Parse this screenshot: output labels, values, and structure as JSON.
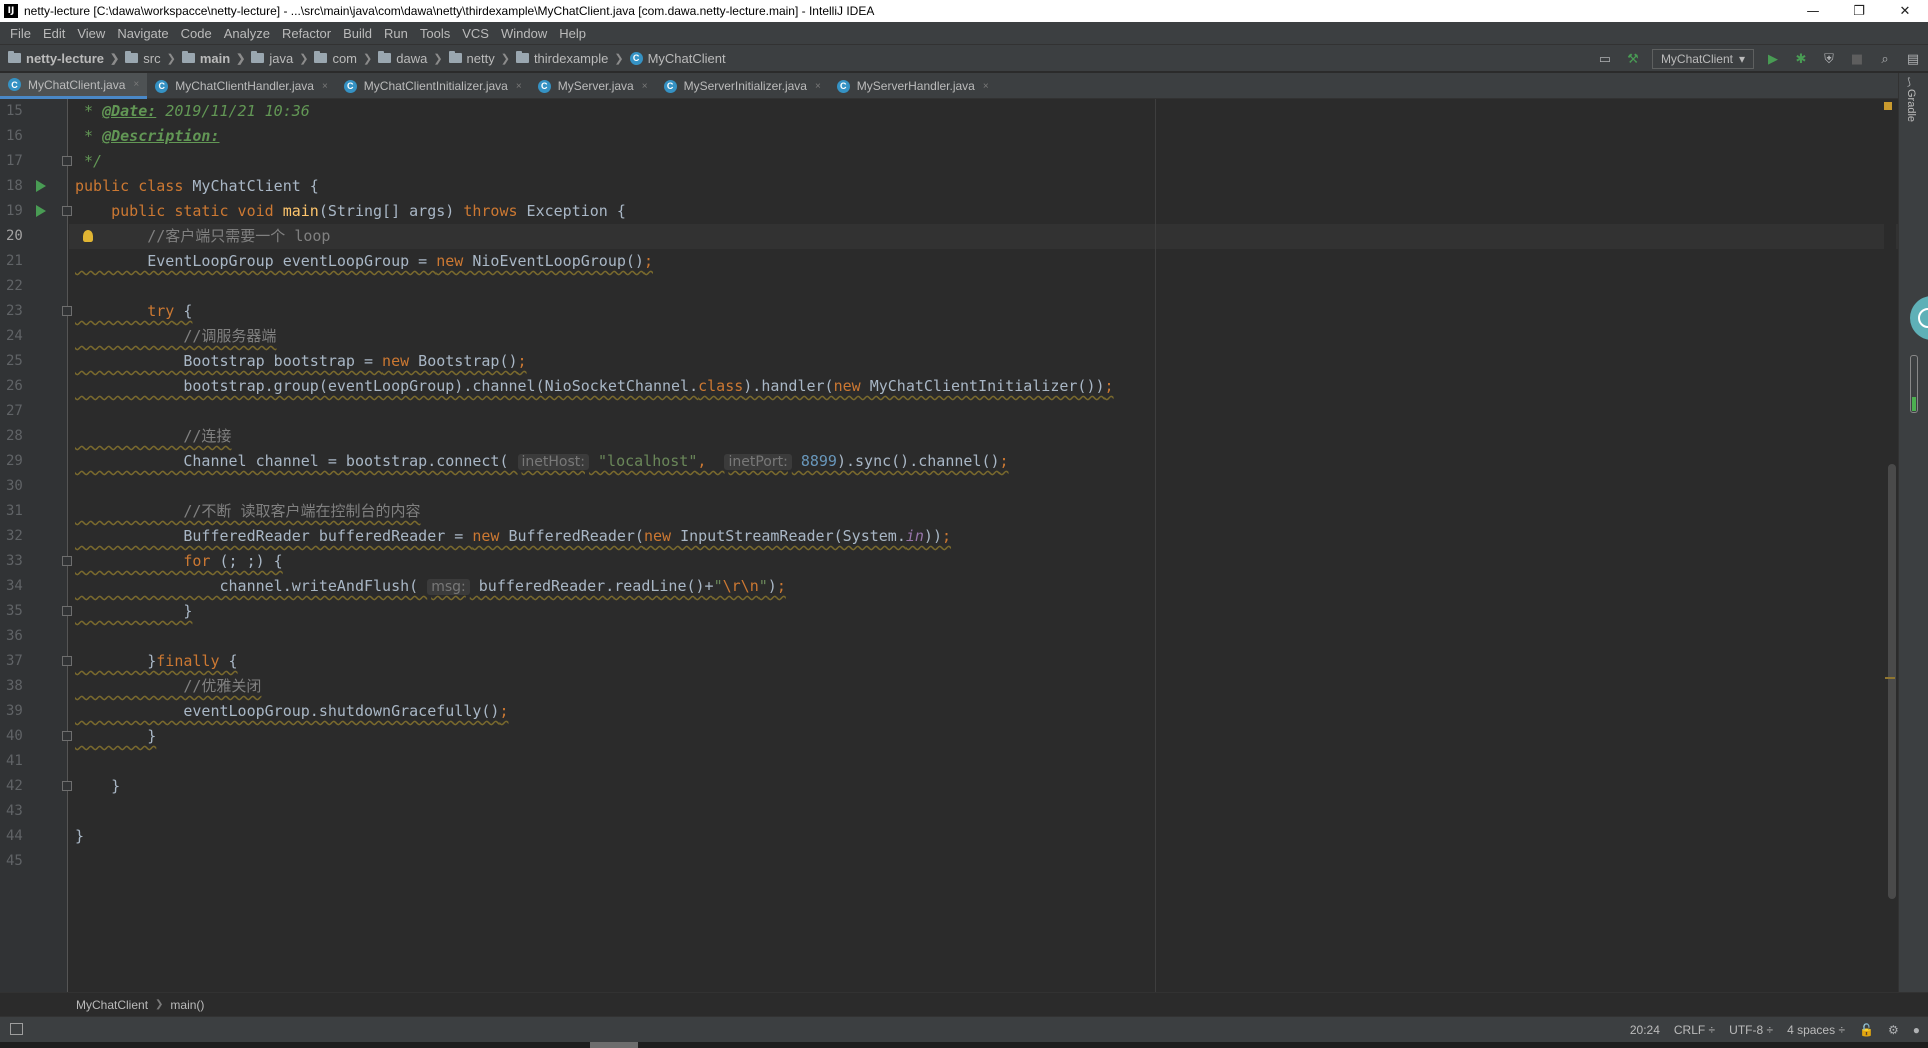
{
  "window": {
    "title": "netty-lecture [C:\\dawa\\workspacce\\netty-lecture] - ...\\src\\main\\java\\com\\dawa\\netty\\thirdexample\\MyChatClient.java [com.dawa.netty-lecture.main] - IntelliJ IDEA",
    "app_icon": "IJ",
    "minimize": "—",
    "restore": "❐",
    "close": "✕"
  },
  "menu": [
    "File",
    "Edit",
    "View",
    "Navigate",
    "Code",
    "Analyze",
    "Refactor",
    "Build",
    "Run",
    "Tools",
    "VCS",
    "Window",
    "Help"
  ],
  "breadcrumbs": [
    "netty-lecture",
    "src",
    "main",
    "java",
    "com",
    "dawa",
    "netty",
    "thirdexample",
    "MyChatClient"
  ],
  "run_config": {
    "label": "MyChatClient",
    "arrow": "▾"
  },
  "toolbar_icons": {
    "layout": "▭",
    "build": "⚒",
    "run": "▶",
    "debug": "✱",
    "coverage": "⛨",
    "stop": "■",
    "search": "⌕",
    "structure": "▤"
  },
  "tabs": [
    {
      "label": "MyChatClient.java",
      "active": true
    },
    {
      "label": "MyChatClientHandler.java",
      "active": false
    },
    {
      "label": "MyChatClientInitializer.java",
      "active": false
    },
    {
      "label": "MyServer.java",
      "active": false
    },
    {
      "label": "MyServerInitializer.java",
      "active": false
    },
    {
      "label": "MyServerHandler.java",
      "active": false
    }
  ],
  "tab_close": "×",
  "class_icon_letter": "C",
  "editor": {
    "line_numbers": [
      "15",
      "16",
      "17",
      "18",
      "19",
      "20",
      "21",
      "22",
      "23",
      "24",
      "25",
      "26",
      "27",
      "28",
      "29",
      "30",
      "31",
      "32",
      "33",
      "34",
      "35",
      "36",
      "37",
      "38",
      "39",
      "40",
      "41",
      "42",
      "43",
      "44",
      "45"
    ],
    "current_line": "20",
    "code": {
      "l15_prefix": " * ",
      "l15_tag": "@Date:",
      "l15_rest": " 2019/11/21 10:36",
      "l16_prefix": " * ",
      "l16_tag": "@Description:",
      "l17": " */",
      "l18_kw": "public class",
      "l18_rest": " MyChatClient {",
      "l19_kw1": "    public static void",
      "l19_fn": " main",
      "l19_mid": "(String[] args) ",
      "l19_kw2": "throws",
      "l19_rest": " Exception {",
      "l20_cm": "        //客户端只需要一个 loop",
      "l21_a": "        EventLoopGroup eventLoopGroup = ",
      "l21_kw": "new",
      "l21_b": " NioEventLoopGroup()",
      "l21_semi": ";",
      "l23_kw": "        try",
      "l23_rest": " {",
      "l24_cm": "            //调服务器端",
      "l25_a": "            Bootstrap bootstrap = ",
      "l25_kw": "new",
      "l25_b": " Bootstrap()",
      "l25_semi": ";",
      "l26_a": "            bootstrap.group(eventLoopGroup).channel(NioSocketChannel.",
      "l26_kw1": "class",
      "l26_b": ").handler(",
      "l26_kw2": "new",
      "l26_c": " MyChatClientInitializer())",
      "l26_semi": ";",
      "l28_cm": "            //连接",
      "l29_a": "            Channel channel = bootstrap.connect( ",
      "l29_h1": "inetHost:",
      "l29_str": " \"localhost\"",
      "l29_comma": ",  ",
      "l29_h2": "inetPort:",
      "l29_num": " 8899",
      "l29_b": ").sync().channel()",
      "l29_semi": ";",
      "l31_cm": "            //不断 读取客户端在控制台的内容",
      "l32_a": "            BufferedReader bufferedReader = ",
      "l32_kw1": "new",
      "l32_b": " BufferedReader(",
      "l32_kw2": "new",
      "l32_c": " InputStreamReader(System.",
      "l32_static": "in",
      "l32_d": "))",
      "l32_semi": ";",
      "l33_kw": "            for",
      "l33_rest": " (; ;) {",
      "l34_a": "                channel.writeAndFlush( ",
      "l34_h": "msg:",
      "l34_b": " bufferedReader.readLine()+",
      "l34_str": "\"",
      "l34_esc": "\\r\\n",
      "l34_str2": "\"",
      "l34_c": ")",
      "l34_semi": ";",
      "l35": "            }",
      "l37_a": "        }",
      "l37_kw": "finally",
      "l37_rest": " {",
      "l38_cm": "            //优雅关闭",
      "l39_a": "            eventLoopGroup.shutdownGracefully()",
      "l39_semi": ";",
      "l40": "        }",
      "l42": "    }",
      "l44": "}"
    }
  },
  "right_panel": {
    "label": "Gradle",
    "icon": "⟆"
  },
  "editor_breadcrumbs": [
    "MyChatClient",
    "main()"
  ],
  "status": {
    "position": "20:24",
    "line_sep": "CRLF ÷",
    "encoding": "UTF-8 ÷",
    "indent": "4 spaces ÷",
    "lock_icon": "🔓",
    "vcs_icon": "⚙",
    "event_icon": "●"
  },
  "colors": {
    "editor_bg": "#2b2b2b",
    "keyword": "#cc7832",
    "comment": "#808080",
    "string": "#6a8759",
    "number": "#6897bb",
    "function": "#ffc66d",
    "accent": "#4a88c7"
  }
}
